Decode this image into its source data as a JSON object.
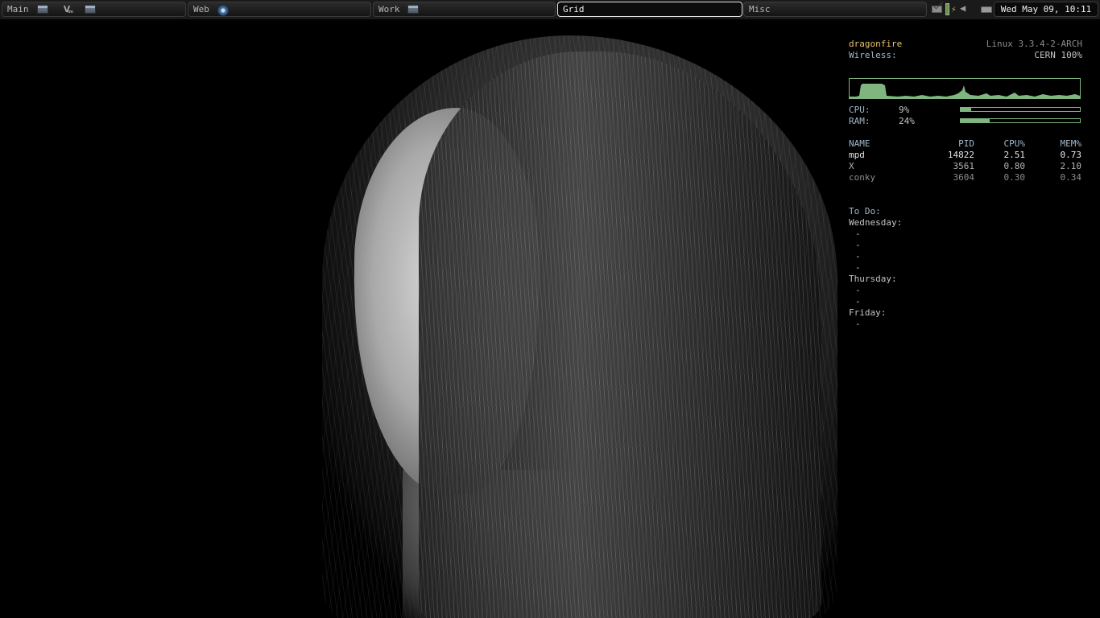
{
  "panel": {
    "workspaces": [
      {
        "label": "Main",
        "active": false
      },
      {
        "label": "Web",
        "active": false
      },
      {
        "label": "Work",
        "active": false
      },
      {
        "label": "Grid",
        "active": true
      },
      {
        "label": "Misc",
        "active": false
      }
    ],
    "tray_icons": [
      "mail-icon",
      "battery-icon",
      "network-icon",
      "volume-icon",
      "keyboard-icon"
    ],
    "clock": "Wed May 09, 10:11"
  },
  "conky": {
    "hostname": "dragonfire",
    "kernel": "Linux 3.3.4-2-ARCH",
    "wireless_label": "Wireless:",
    "wireless_value": "CERN 100%",
    "cpu_label": "CPU:",
    "cpu_value": "9%",
    "cpu_fraction": 0.09,
    "ram_label": "RAM:",
    "ram_value": "24%",
    "ram_fraction": 0.24,
    "proc_headers": [
      "NAME",
      "PID",
      "CPU%",
      "MEM%"
    ],
    "processes": [
      {
        "name": "mpd",
        "pid": "14822",
        "cpu": "2.51",
        "mem": "0.73"
      },
      {
        "name": "X",
        "pid": "3561",
        "cpu": "0.80",
        "mem": "2.10"
      },
      {
        "name": "conky",
        "pid": "3604",
        "cpu": "0.30",
        "mem": "0.34"
      }
    ],
    "todo_title": "To Do:",
    "todo": [
      {
        "day": "Wednesday:",
        "items": [
          "-",
          "-",
          "-",
          "-"
        ]
      },
      {
        "day": "Thursday:",
        "items": [
          "-",
          "-"
        ]
      },
      {
        "day": "Friday:",
        "items": [
          "-"
        ]
      }
    ]
  },
  "colors": {
    "accent_yellow": "#e8c16d",
    "graph_green": "#7fb67f",
    "panel_bg": "#1a1a1a"
  }
}
